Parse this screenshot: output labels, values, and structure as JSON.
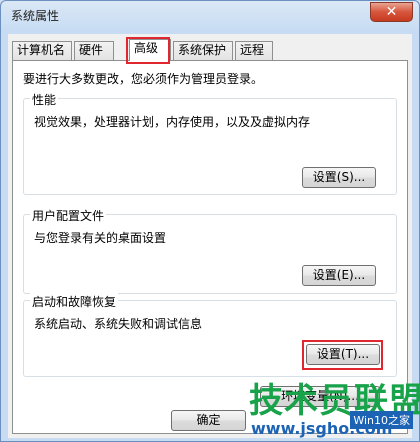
{
  "window": {
    "title": "系统属性",
    "close_glyph": "✕"
  },
  "tabs": [
    {
      "label": "计算机名"
    },
    {
      "label": "硬件"
    },
    {
      "label": "高级",
      "active": true
    },
    {
      "label": "系统保护"
    },
    {
      "label": "远程"
    }
  ],
  "panel": {
    "intro": "要进行大多数更改，您必须作为管理员登录。",
    "performance": {
      "title": "性能",
      "desc": "视觉效果，处理器计划，内存使用，以及及虚拟内存",
      "button": "设置(S)..."
    },
    "profile": {
      "title": "用户配置文件",
      "desc": "与您登录有关的桌面设置",
      "button": "设置(E)..."
    },
    "startup": {
      "title": "启动和故障恢复",
      "desc": "系统启动、系统失败和调试信息",
      "button": "设置(T)..."
    },
    "env_button": "环境变量(N)..."
  },
  "footer": {
    "ok_button": "确定"
  },
  "watermark": {
    "brand": "技术员联盟",
    "url": "www.jsgho.com",
    "tag": "Win10之家"
  },
  "colors": {
    "highlight": "#e0262e",
    "watermark_green": "#18a34a",
    "watermark_blue": "#1d63b5"
  }
}
